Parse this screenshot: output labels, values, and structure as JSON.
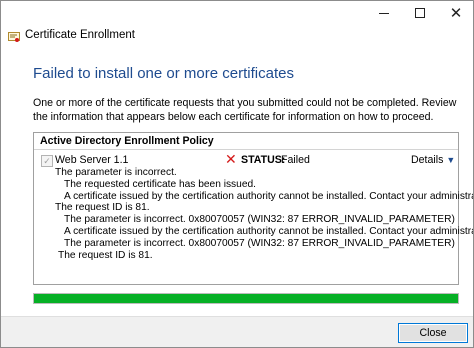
{
  "window": {
    "title": "Certificate Enrollment",
    "controls": {
      "minimize": "minimize",
      "maximize": "maximize",
      "close": "✕"
    }
  },
  "heading": "Failed to install one or more certificates",
  "intro": "One or more of the certificate requests that you submitted could not be completed. Review the information that appears below each certificate for information on how to proceed.",
  "policy": {
    "title": "Active Directory Enrollment Policy",
    "certificate": {
      "name": "Web Server 1.1",
      "checked": true,
      "status_label": "STATUS:",
      "status_value": "Failed",
      "details_label": "Details",
      "messages": [
        "The parameter is incorrect.",
        "The requested certificate has been issued.",
        "A certificate issued by the certification authority cannot be installed. Contact your administrator.",
        "The request ID is 81.",
        "The parameter is incorrect. 0x80070057 (WIN32: 87 ERROR_INVALID_PARAMETER)",
        "A certificate issued by the certification authority cannot be installed. Contact your administrator.",
        "The parameter is incorrect. 0x80070057 (WIN32: 87 ERROR_INVALID_PARAMETER)",
        "The request ID is 81."
      ]
    }
  },
  "progress": 1.0,
  "colors": {
    "accent": "#1e4b8f",
    "progress": "#06b025",
    "error": "#d41a1a"
  },
  "icons": {
    "app": "certificate-icon",
    "status": "error-x-icon",
    "details": "chevron-down-icon"
  },
  "footer": {
    "close_label": "Close"
  }
}
